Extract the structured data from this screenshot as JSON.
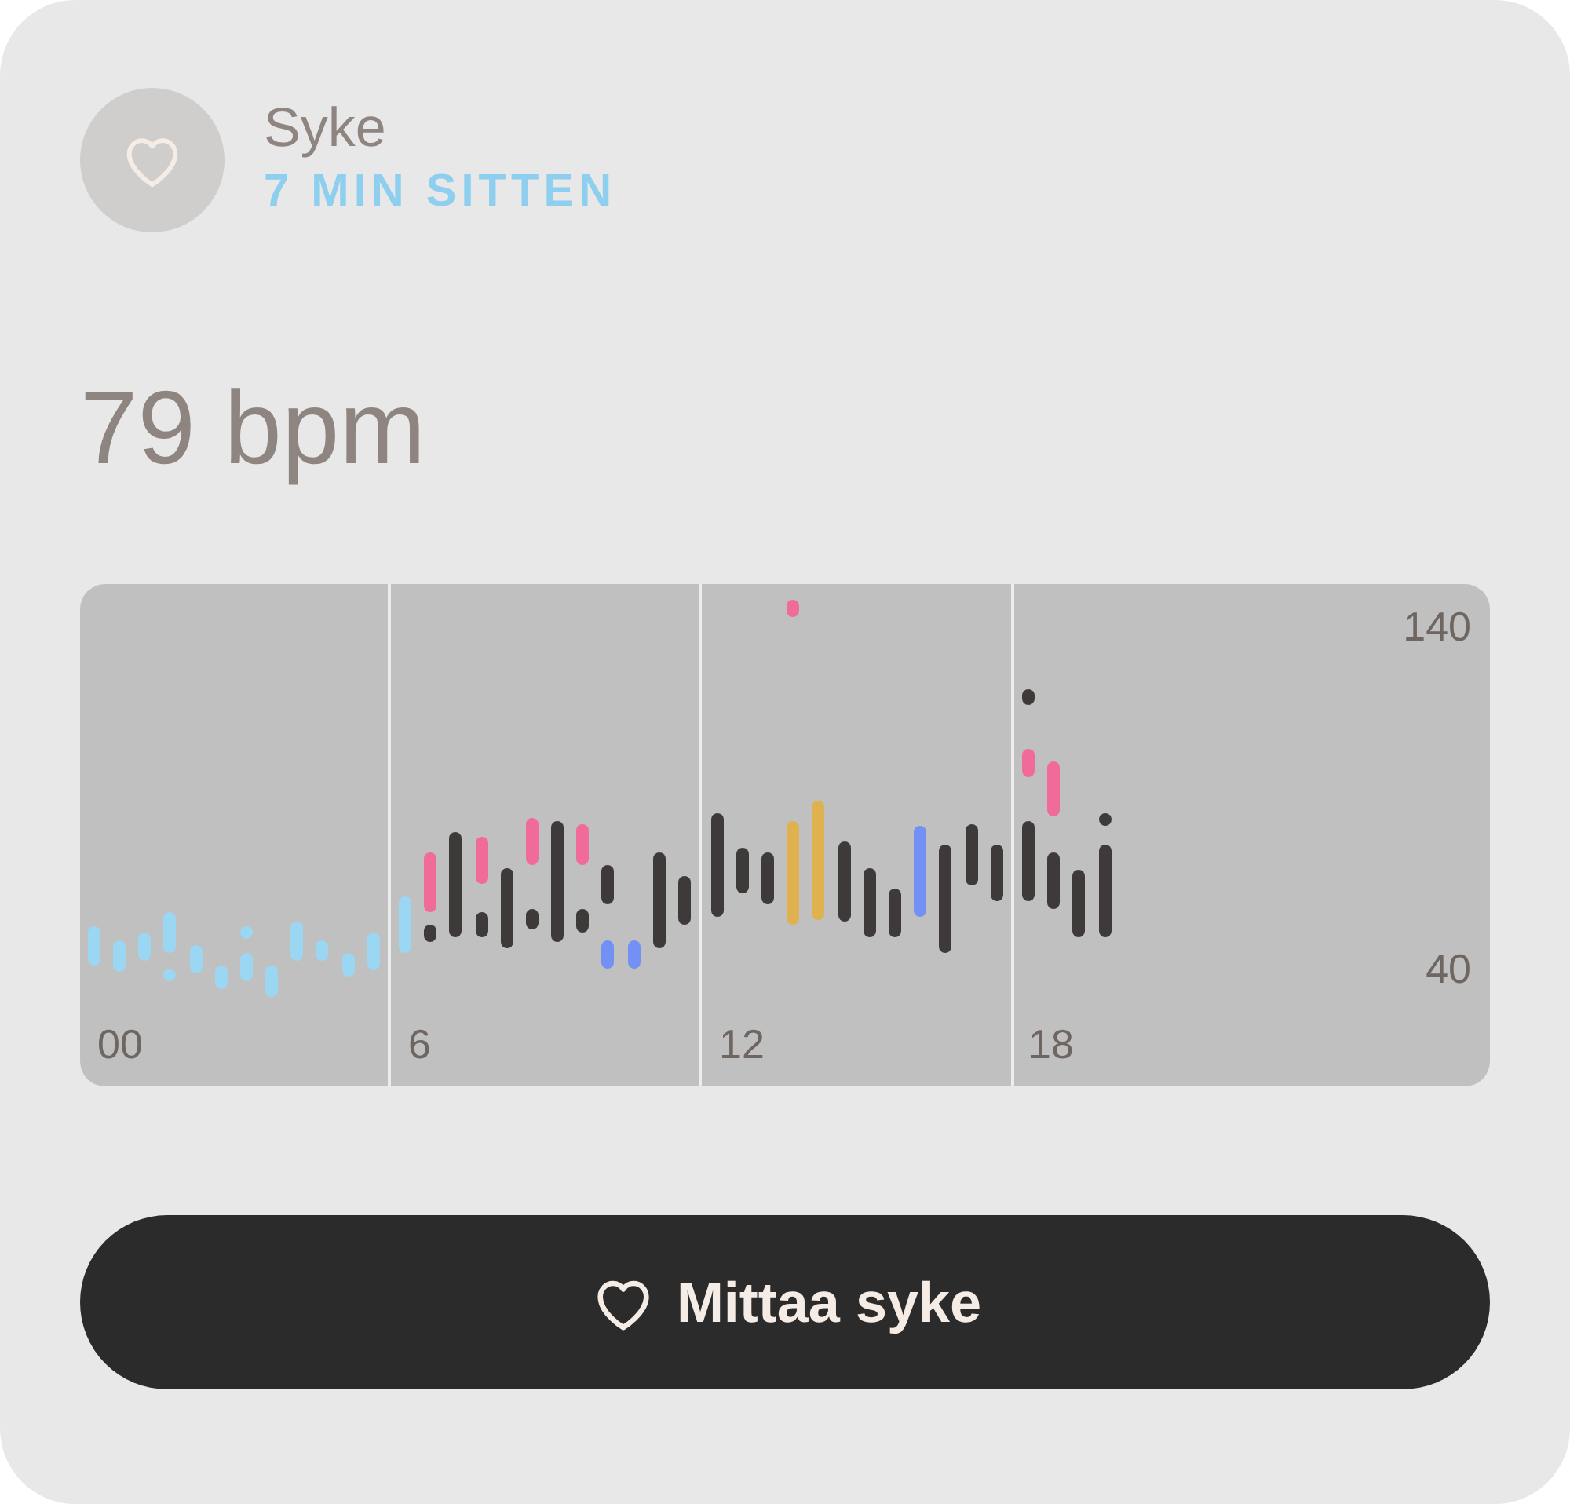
{
  "header": {
    "title": "Syke",
    "subtitle": "7 MIN SITTEN"
  },
  "reading": "79 bpm",
  "chart": {
    "x_labels": [
      "00",
      "6",
      "12",
      "18"
    ],
    "y_labels": [
      "140",
      "40"
    ]
  },
  "button": {
    "label": "Mittaa syke"
  }
}
